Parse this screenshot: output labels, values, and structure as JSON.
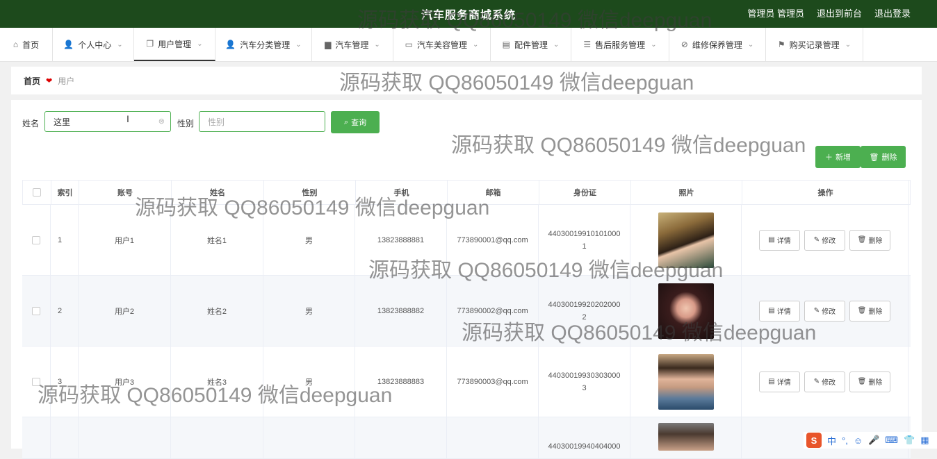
{
  "header": {
    "title": "汽车服务商城系统",
    "user": "管理员 管理员",
    "back_front": "退出到前台",
    "logout": "退出登录"
  },
  "nav": [
    {
      "label": "首页",
      "icon": "home-icon",
      "glyph": "⌂"
    },
    {
      "label": "个人中心",
      "icon": "user-icon",
      "glyph": "👤"
    },
    {
      "label": "用户管理",
      "icon": "copy-icon",
      "glyph": "❐"
    },
    {
      "label": "汽车分类管理",
      "icon": "user-icon",
      "glyph": "👤"
    },
    {
      "label": "汽车管理",
      "icon": "briefcase-icon",
      "glyph": "▆"
    },
    {
      "label": "汽车美容管理",
      "icon": "chat-icon",
      "glyph": "▭"
    },
    {
      "label": "配件管理",
      "icon": "card-icon",
      "glyph": "▤"
    },
    {
      "label": "售后服务管理",
      "icon": "list-icon",
      "glyph": "☰"
    },
    {
      "label": "维修保养管理",
      "icon": "bell-off-icon",
      "glyph": "⊘"
    },
    {
      "label": "购买记录管理",
      "icon": "flag-icon",
      "glyph": "⚑"
    }
  ],
  "breadcrumb": {
    "home": "首页",
    "current": "用户"
  },
  "search": {
    "name_label": "姓名",
    "name_value": "这里",
    "gender_label": "性别",
    "gender_placeholder": "性别",
    "query_label": "查询"
  },
  "actions": {
    "add_label": "新增",
    "delete_label": "删除"
  },
  "table": {
    "headers": [
      "索引",
      "账号",
      "姓名",
      "性别",
      "手机",
      "邮箱",
      "身份证",
      "照片",
      "操作"
    ],
    "rows": [
      {
        "index": "1",
        "account": "用户1",
        "name": "姓名1",
        "gender": "男",
        "phone": "13823888881",
        "email": "773890001@qq.com",
        "id_line1": "44030019910101000",
        "id_line2": "1"
      },
      {
        "index": "2",
        "account": "用户2",
        "name": "姓名2",
        "gender": "男",
        "phone": "13823888882",
        "email": "773890002@qq.com",
        "id_line1": "44030019920202000",
        "id_line2": "2"
      },
      {
        "index": "3",
        "account": "用户3",
        "name": "姓名3",
        "gender": "男",
        "phone": "13823888883",
        "email": "773890003@qq.com",
        "id_line1": "44030019930303000",
        "id_line2": "3"
      },
      {
        "index": "",
        "account": "",
        "name": "",
        "gender": "",
        "phone": "",
        "email": "",
        "id_line1": "44030019940404000",
        "id_line2": ""
      }
    ],
    "row_buttons": {
      "detail": "详情",
      "edit": "修改",
      "delete": "删除"
    }
  },
  "watermark": "源码获取 QQ86050149 微信deepguan",
  "ime": {
    "lang": "中",
    "punct": "°,"
  }
}
